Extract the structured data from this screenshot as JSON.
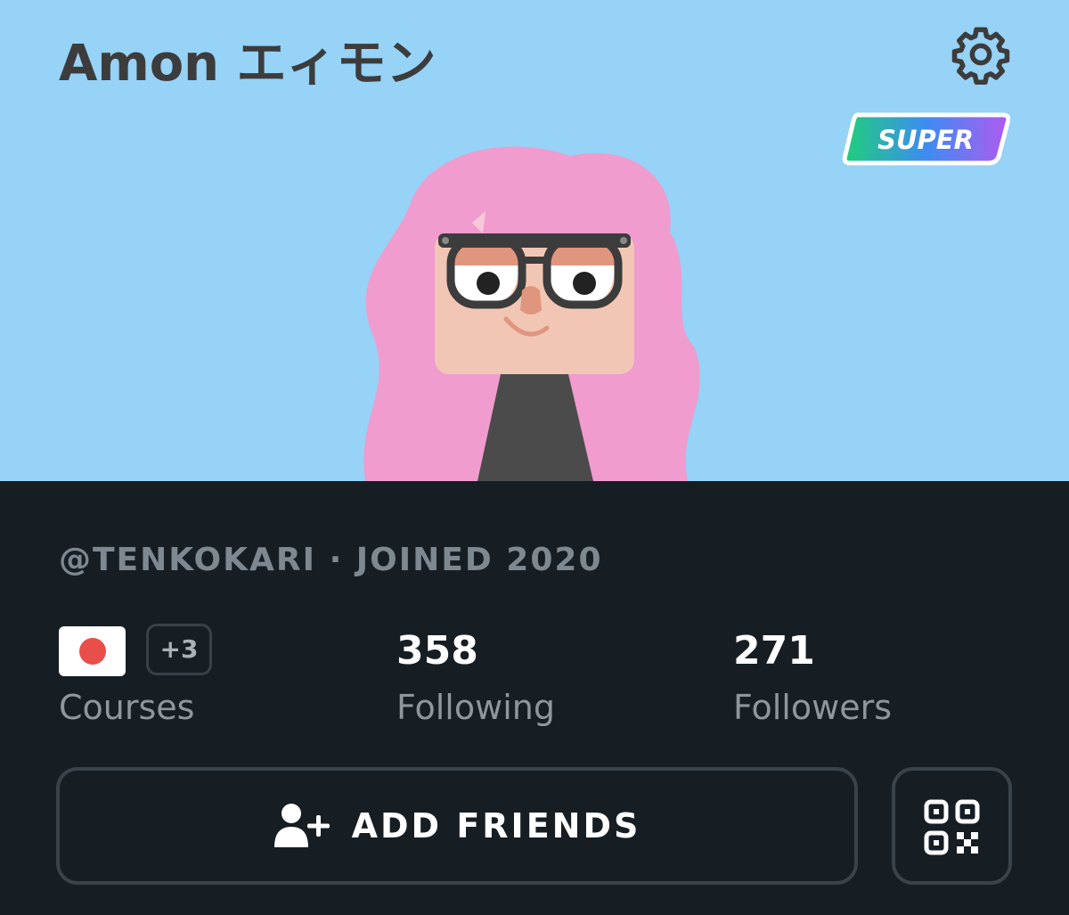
{
  "profile": {
    "display_name": "Amon エィモン",
    "badge": "SUPER",
    "meta_line": "@TENKOKARI · JOINED 2020"
  },
  "header": {
    "settings_icon": "gear-icon"
  },
  "stats": {
    "courses": {
      "extra": "+3",
      "label": "Courses",
      "flag_icon": "japan-flag-icon"
    },
    "following": {
      "value": "358",
      "label": "Following"
    },
    "followers": {
      "value": "271",
      "label": "Followers"
    }
  },
  "actions": {
    "add_friends_label": "ADD FRIENDS",
    "add_friends_icon": "add-user-icon",
    "qr_icon": "qr-code-icon"
  },
  "colors": {
    "header_bg": "#97d2f7",
    "footer_bg": "#161d23",
    "hair": "#f09cce"
  }
}
